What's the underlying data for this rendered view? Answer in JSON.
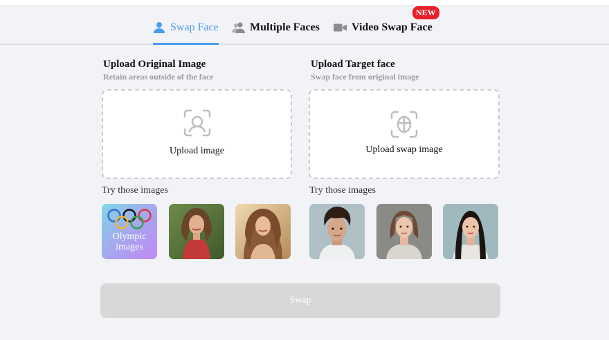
{
  "tabs": [
    {
      "label": "Swap Face",
      "icon": "user-icon"
    },
    {
      "label": "Multiple Faces",
      "icon": "users-icon"
    },
    {
      "label": "Video Swap Face",
      "icon": "video-camera-icon"
    }
  ],
  "new_badge": "NEW",
  "left": {
    "title": "Upload Original Image",
    "subtitle": "Retain areas outside of the face",
    "upload_label": "Upload image",
    "try_label": "Try those images",
    "samples": [
      "Olympic images",
      "photo-woman-red-dress",
      "photo-woman-sunset"
    ]
  },
  "right": {
    "title": "Upload Target face",
    "subtitle": "Swap face from original image",
    "upload_label": "Upload swap image",
    "try_label": "Try those images",
    "samples": [
      "photo-man-curly-hair",
      "photo-woman-freckles",
      "photo-woman-asian"
    ]
  },
  "olympic_text": "Olympic images",
  "swap_button": "Swap",
  "colors": {
    "accent": "#4a9cf0",
    "badge": "#e8202a",
    "disabled_button": "#d8d8d8"
  }
}
